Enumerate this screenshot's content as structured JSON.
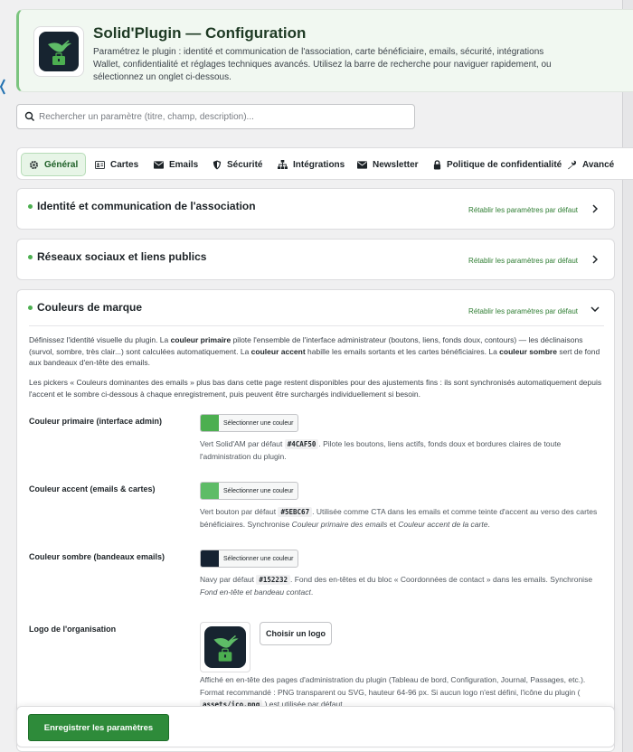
{
  "header": {
    "title": "Solid'Plugin — Configuration",
    "description": "Paramétrez le plugin : identité et communication de l'association, carte bénéficiaire, emails, sécurité, intégrations Wallet, confidentialité et réglages techniques avancés. Utilisez la barre de recherche pour naviguer rapidement, ou sélectionnez un onglet ci-dessous."
  },
  "search": {
    "placeholder": "Rechercher un paramètre (titre, champ, description)..."
  },
  "tabs": [
    {
      "label": "Général",
      "icon": "gear-icon",
      "active": true
    },
    {
      "label": "Cartes",
      "icon": "id-card-icon"
    },
    {
      "label": "Emails",
      "icon": "envelope-icon"
    },
    {
      "label": "Sécurité",
      "icon": "shield-icon"
    },
    {
      "label": "Intégrations",
      "icon": "sitemap-icon"
    },
    {
      "label": "Newsletter",
      "icon": "envelope-icon"
    },
    {
      "label": "Politique de confidentialité",
      "icon": "lock-icon"
    },
    {
      "label": "Avancé",
      "icon": "wrench-icon"
    }
  ],
  "sections": [
    {
      "title": "Identité et communication de l'association",
      "reset": "Rétablir les paramètres par défaut"
    },
    {
      "title": "Réseaux sociaux et liens publics",
      "reset": "Rétablir les paramètres par défaut"
    },
    {
      "title": "Couleurs de marque",
      "reset": "Rétablir les paramètres par défaut"
    }
  ],
  "colors": {
    "intro1": {
      "a": "Définissez l'identité visuelle du plugin. La ",
      "b": "couleur primaire",
      "c": " pilote l'ensemble de l'interface administrateur (boutons, liens, fonds doux, contours) — les déclinaisons (survol, sombre, très clair...) sont calculées automatiquement. La ",
      "d": "couleur accent",
      "e": " habille les emails sortants et les cartes bénéficiaires. La ",
      "f": "couleur sombre",
      "g": " sert de fond aux bandeaux d'en-tête des emails."
    },
    "intro2": "Les pickers « Couleurs dominantes des emails » plus bas dans cette page restent disponibles pour des ajustements fins : ils sont synchronisés automatiquement depuis l'accent et le sombre ci-dessous à chaque enregistrement, puis peuvent être surchargés individuellement si besoin.",
    "picker_label": "Sélectionner une couleur",
    "primary": {
      "label": "Couleur primaire (interface admin)",
      "swatch": "#4CAF50",
      "help_a": "Vert Solid'AM par défaut ",
      "code": "#4CAF50",
      "help_b": ". Pilote les boutons, liens actifs, fonds doux et bordures claires de toute l'administration du plugin."
    },
    "accent": {
      "label": "Couleur accent (emails & cartes)",
      "swatch": "#5EBC67",
      "help_a": "Vert bouton par défaut ",
      "code": "#5EBC67",
      "help_b": ". Utilisée comme CTA dans les emails et comme teinte d'accent au verso des cartes bénéficiaires. Synchronise ",
      "help_i1": "Couleur primaire des emails",
      "help_c": " et ",
      "help_i2": "Couleur accent de la carte",
      "help_d": "."
    },
    "dark": {
      "label": "Couleur sombre (bandeaux emails)",
      "swatch": "#152232",
      "help_a": "Navy par défaut ",
      "code": "#152232",
      "help_b": ". Fond des en-têtes et du bloc « Coordonnées de contact » dans les emails. Synchronise ",
      "help_i1": "Fond en-tête et bandeau contact",
      "help_c": "."
    },
    "logo": {
      "label": "Logo de l'organisation",
      "button": "Choisir un logo",
      "help_a": "Affiché en en-tête des pages d'administration du plugin (Tableau de bord, Configuration, Journal, Passages, etc.). Format recommandé : PNG transparent ou SVG, hauteur 64-96 px. Si aucun logo n'est défini, l'icône du plugin ( ",
      "code": "assets/ico.png",
      "help_b": " ) est utilisée par défaut."
    }
  },
  "footer": {
    "save_label": "Enregistrer les paramètres"
  },
  "theme": {
    "accent": "#4CAF50",
    "save_button": "#2E8B3A"
  }
}
